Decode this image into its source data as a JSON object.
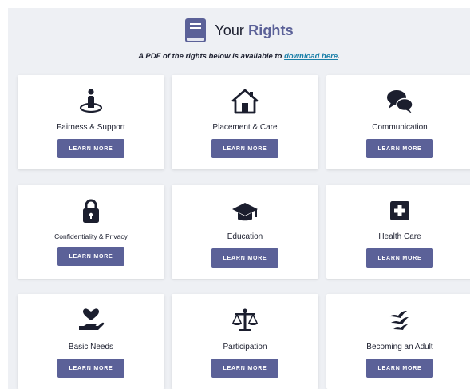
{
  "header": {
    "title_prefix": "Your",
    "title_accent": "Rights",
    "pdf_text": "A PDF of the rights below is available to",
    "pdf_link": "download here",
    "pdf_suffix": "."
  },
  "cards": [
    {
      "label": "Fairness & Support",
      "icon": "person-target-icon",
      "button": "LEARN MORE"
    },
    {
      "label": "Placement & Care",
      "icon": "house-icon",
      "button": "LEARN MORE"
    },
    {
      "label": "Communication",
      "icon": "chat-bubbles-icon",
      "button": "LEARN MORE"
    },
    {
      "label": "Confidentiality & Privacy",
      "icon": "lock-icon",
      "button": "LEARN MORE"
    },
    {
      "label": "Education",
      "icon": "graduation-cap-icon",
      "button": "LEARN MORE"
    },
    {
      "label": "Health Care",
      "icon": "medical-cross-icon",
      "button": "LEARN MORE"
    },
    {
      "label": "Basic Needs",
      "icon": "heart-hand-icon",
      "button": "LEARN MORE"
    },
    {
      "label": "Participation",
      "icon": "balance-scale-icon",
      "button": "LEARN MORE"
    },
    {
      "label": "Becoming an Adult",
      "icon": "birds-icon",
      "button": "LEARN MORE"
    }
  ],
  "colors": {
    "accent": "#5b6198",
    "link": "#1a7fa8",
    "icon": "#1b1e2e",
    "background": "#eef0f4"
  }
}
